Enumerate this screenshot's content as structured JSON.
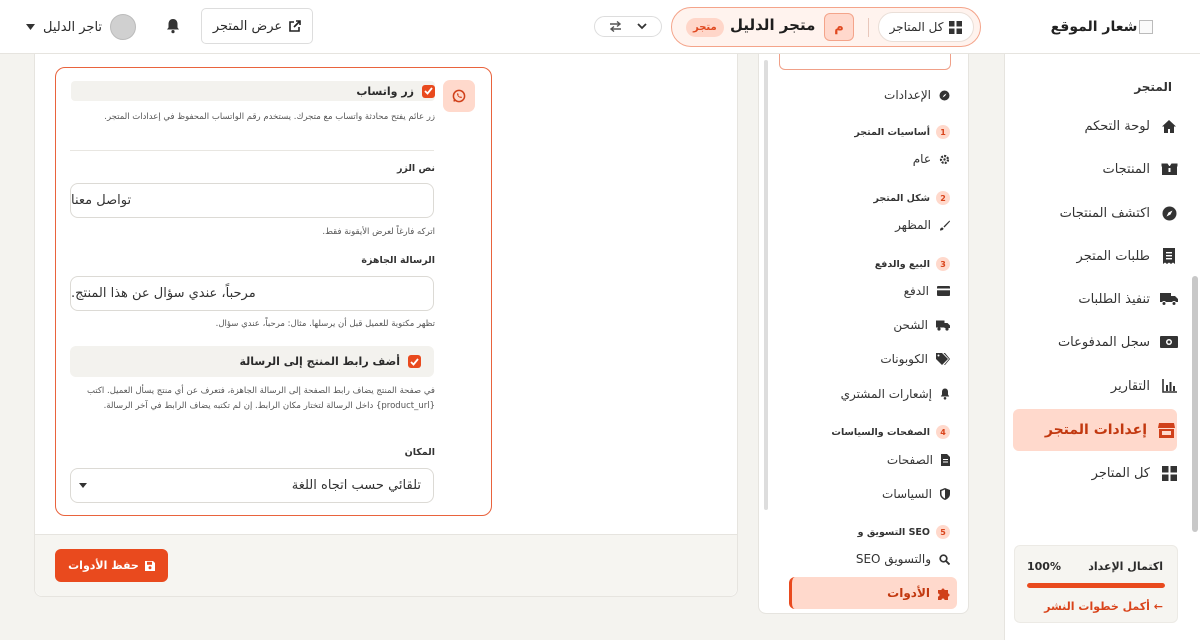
{
  "topbar": {
    "logo_text": "شعار الموقع",
    "all_stores_label": "كل المتاجر",
    "store_initial": "م",
    "store_name": "متجر الدليل",
    "store_badge": "متجر",
    "view_store_label": "عرض المتجر",
    "user_name": "تاجر الدليل"
  },
  "sidebar": {
    "section_title": "المتجر",
    "items": [
      {
        "label": "لوحة التحكم",
        "icon": "home-icon"
      },
      {
        "label": "المنتجات",
        "icon": "boxes-icon"
      },
      {
        "label": "اكتشف المنتجات",
        "icon": "compass-icon"
      },
      {
        "label": "طلبات المتجر",
        "icon": "receipt-icon"
      },
      {
        "label": "تنفيذ الطلبات",
        "icon": "truck-icon"
      },
      {
        "label": "سجل المدفوعات",
        "icon": "money-icon"
      },
      {
        "label": "التقارير",
        "icon": "chart-icon"
      },
      {
        "label": "إعدادات المتجر",
        "icon": "store-icon",
        "active": true
      },
      {
        "label": "كل المتاجر",
        "icon": "grid-icon"
      }
    ],
    "progress": {
      "title": "اكتمال الإعداد",
      "percent_label": "100%",
      "percent": 100,
      "link": "أكمل خطوات النشر ←"
    }
  },
  "settings_nav": {
    "top_item": "الإعدادات",
    "groups": [
      {
        "num": "1",
        "title": "أساسيات المتجر",
        "items": [
          "عام"
        ]
      },
      {
        "num": "2",
        "title": "شكل المتجر",
        "items": [
          "المظهر"
        ]
      },
      {
        "num": "3",
        "title": "البيع والدفع",
        "items": [
          "الدفع",
          "الشحن",
          "الكوبونات",
          "إشعارات المشتري"
        ]
      },
      {
        "num": "4",
        "title": "الصفحات والسياسات",
        "items": [
          "الصفحات",
          "السياسات"
        ]
      },
      {
        "num": "5",
        "title": "التسويق و SEO",
        "items": [
          "SEO والتسويق",
          "الأدوات"
        ]
      }
    ]
  },
  "whatsapp": {
    "enabled_label": "زر واتساب",
    "description": "زر عائم يفتح محادثة واتساب مع متجرك. يستخدم رقم الواتساب المحفوظ في إعدادات المتجر.",
    "button_text_label": "نص الزر",
    "button_text_value": "تواصل معنا",
    "button_text_hint": "اتركه فارغاً لعرض الأيقونة فقط.",
    "message_label": "الرسالة الجاهزة",
    "message_value": "مرحباً، عندي سؤال عن هذا المنتج.",
    "message_hint": "تظهر مكتوبة للعميل قبل أن يرسلها. مثال: مرحباً، عندي سؤال.",
    "add_link_label": "أضف رابط المنتج إلى الرسالة",
    "add_link_hint": "في صفحة المنتج يضاف رابط الصفحة إلى الرسالة الجاهزة، فتعرف عن أي منتج يسأل العميل. اكتب {product_url} داخل الرسالة لتختار مكان الرابط. إن لم تكتبه يضاف الرابط في آخر الرسالة.",
    "position_label": "المكان",
    "position_value": "تلقائي حسب اتجاه اللغة"
  },
  "footer": {
    "save_label": "حفظ الأدوات"
  },
  "colors": {
    "accent": "#e94a1e",
    "accent_soft": "#ffd9cc"
  }
}
